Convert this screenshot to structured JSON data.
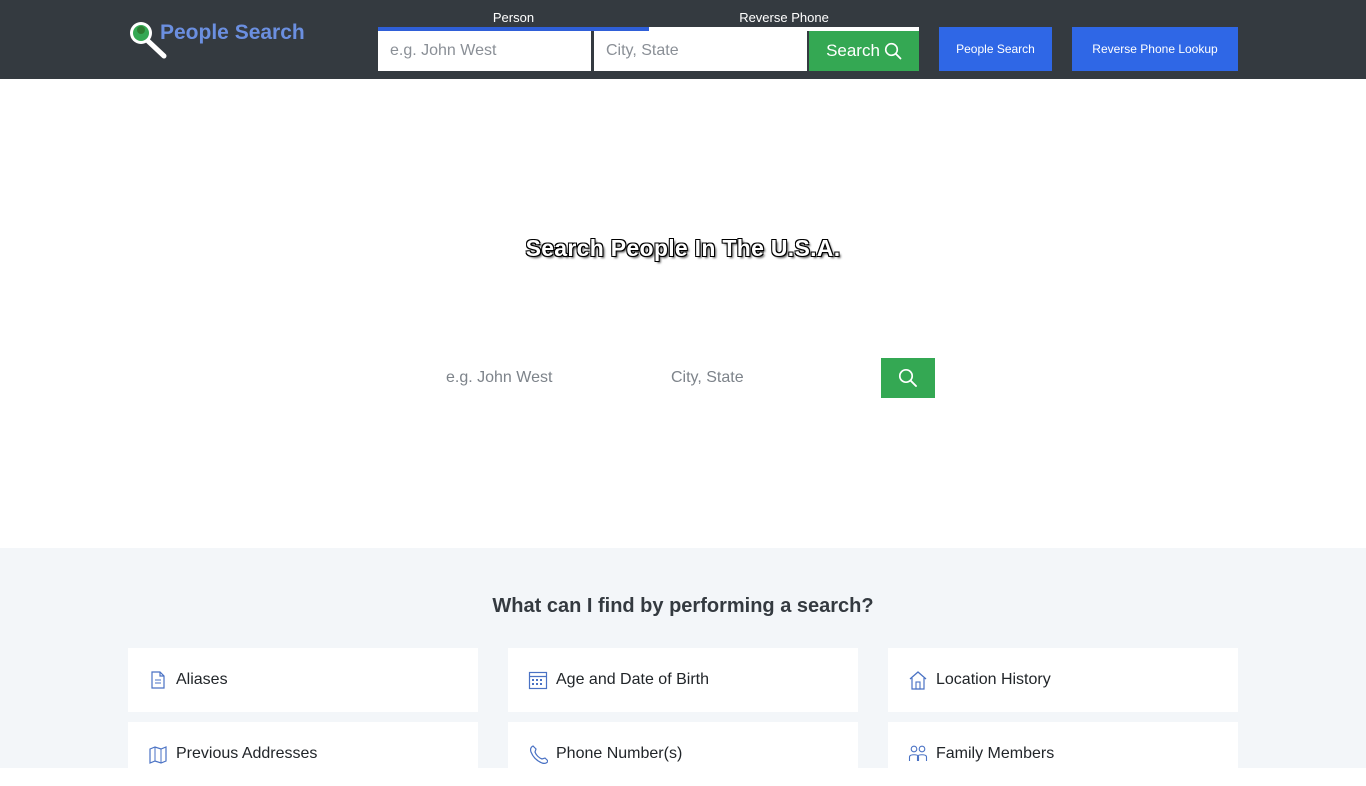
{
  "brand": {
    "name": "People Search"
  },
  "header": {
    "tabs": {
      "person": "Person",
      "reverse_phone": "Reverse Phone"
    },
    "name_placeholder": "e.g. John West",
    "location_placeholder": "City, State",
    "search_label": "Search",
    "people_search_label": "People Search",
    "reverse_phone_label": "Reverse Phone Lookup"
  },
  "hero": {
    "title": "Search People In The U.S.A.",
    "name_placeholder": "e.g. John West",
    "location_placeholder": "City, State"
  },
  "features": {
    "title": "What can I find by performing a search?",
    "items": [
      {
        "label": "Aliases",
        "icon": "document-icon"
      },
      {
        "label": "Age and Date of Birth",
        "icon": "calendar-icon"
      },
      {
        "label": "Location History",
        "icon": "house-icon"
      },
      {
        "label": "Previous Addresses",
        "icon": "map-icon"
      },
      {
        "label": "Phone Number(s)",
        "icon": "phone-icon"
      },
      {
        "label": "Family Members",
        "icon": "family-icon"
      }
    ]
  },
  "colors": {
    "header_bg": "#343a40",
    "accent_green": "#34a853",
    "accent_blue": "#2f67e6",
    "brand_blue": "#6b8fe0",
    "features_bg": "#f3f6f9"
  }
}
